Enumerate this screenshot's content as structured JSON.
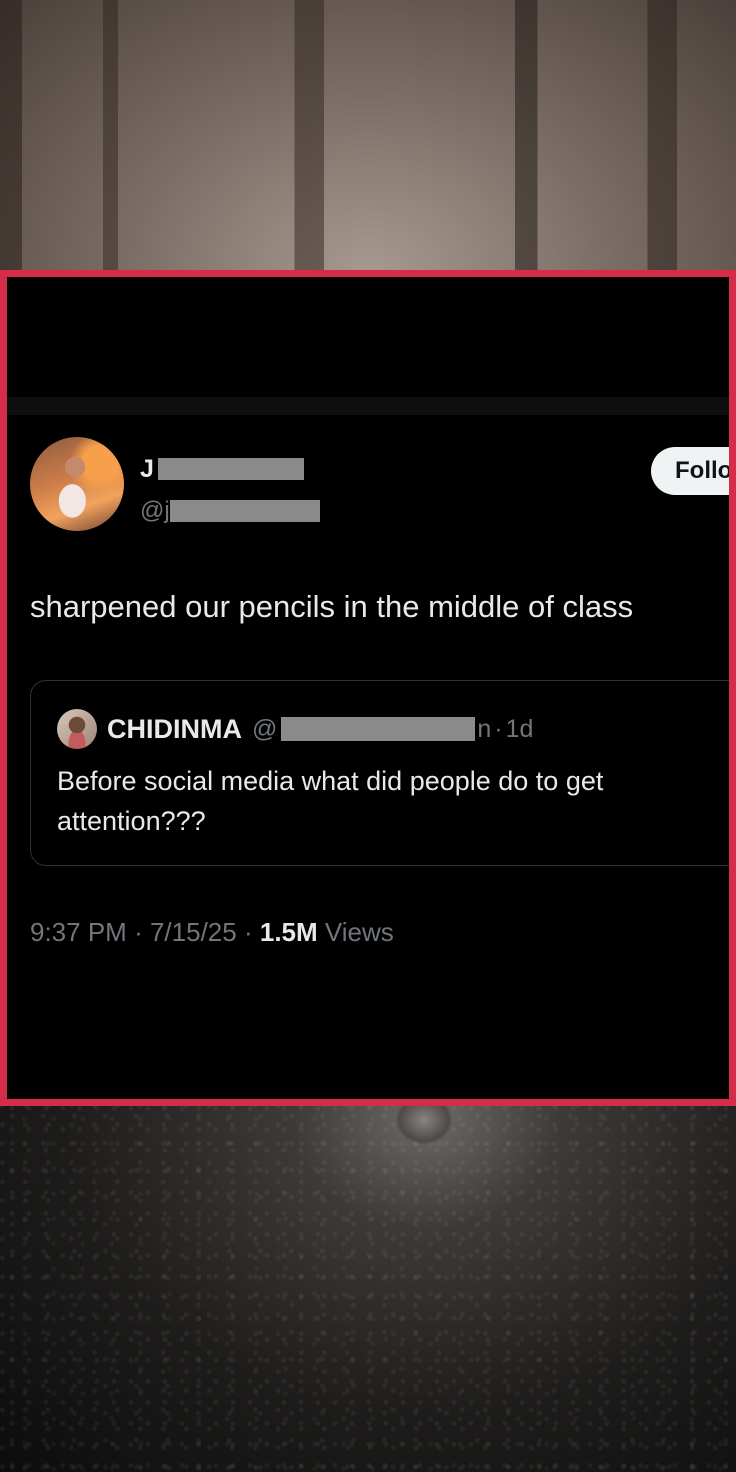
{
  "tweet": {
    "author_initial": "J",
    "handle_prefix": "@j",
    "follow_label": "Follow",
    "text": "sharpened our pencils in the middle of class",
    "quote": {
      "name": "CHIDINMA",
      "handle_prefix": "@",
      "handle_suffix": "n",
      "separator": "·",
      "age": "1d",
      "text": "Before social media what did people do to get attention???"
    },
    "time": "9:37 PM",
    "date": "7/15/25",
    "separator": "·",
    "views_count": "1.5M",
    "views_label": "Views"
  },
  "colors": {
    "frame_border": "#d62b49",
    "card_background": "#000000",
    "text_primary": "#e7e9ea",
    "text_secondary": "#71767b",
    "follow_button": "#eff3f4"
  }
}
